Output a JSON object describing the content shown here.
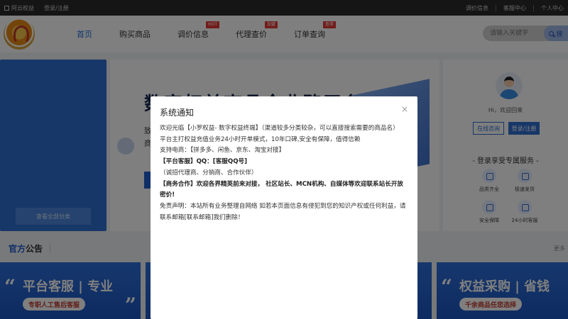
{
  "topbar": {
    "site_name": "阿云权益",
    "login": "登录/注册",
    "right": [
      "调价信息",
      "客服中心",
      "个人中心"
    ]
  },
  "header": {
    "nav": [
      {
        "label": "首页",
        "active": true,
        "badge": ""
      },
      {
        "label": "购买商品",
        "active": false,
        "badge": ""
      },
      {
        "label": "调价信息",
        "active": false,
        "badge": "HOT"
      },
      {
        "label": "代理查价",
        "active": false,
        "badge": "加盟"
      },
      {
        "label": "订单查询",
        "active": false,
        "badge": "查单"
      }
    ],
    "search_placeholder": "请输入关键字",
    "search_button": "搜"
  },
  "left_category": {
    "view_all": "查看全部分类"
  },
  "banner": {
    "title": "数字权益商品全业務平台",
    "sub1": "致",
    "sub2": "商",
    "foot": "品！"
  },
  "right_panel": {
    "welcome": "Hi，欢迎回来",
    "consult": "在线咨询",
    "login": "登录/注册",
    "perk_title": "- 登录享受专属服务 -",
    "perks": [
      "品类齐全",
      "极速发货",
      "安全保障",
      "24小时客服"
    ]
  },
  "notice": {
    "title_a": "官方",
    "title_b": "公告",
    "more": "更多"
  },
  "cards": [
    {
      "main": "平台客服 | 专业",
      "sub": "专职人工售后客服"
    },
    {
      "main": "权益采购 | 省钱",
      "sub": "千余商品任您选择"
    }
  ],
  "modal": {
    "title": "系统通知",
    "close": "×",
    "lines": [
      {
        "text": "欢迎光临【小罗权益- 数字权益终端】（渠道较多分类较杂，可以直接搜索需要的商品名）",
        "bold": false
      },
      {
        "text": "平台主打权益充值业务24小时开单模式，10年口碑,安全有保障，值得信赖",
        "bold": false
      },
      {
        "text": "支持电商：【拼多多、闲鱼、京东、淘宝对接】",
        "bold": false
      },
      {
        "text": "【平台客服】QQ：[客服QQ号]",
        "bold": true
      },
      {
        "text": "（诚招代理商、分销商、合作伙伴）",
        "bold": false
      },
      {
        "text": "【商务合作】欢迎各界精英前来对接， 社区站长、MCN机构、自媒体等欢迎联系站长开放密价!",
        "bold": true
      },
      {
        "text": "免责声明：本站所有业务整理自网络 如若本页面信息有侵犯到您的知识产权或任何利益，请联系邮箱[联系邮箱]我们删除！",
        "bold": false
      }
    ]
  },
  "colors": {
    "brand_blue": "#2f6fd1",
    "badge_red": "#e53935",
    "topbar_bg": "#2b2b2b"
  }
}
